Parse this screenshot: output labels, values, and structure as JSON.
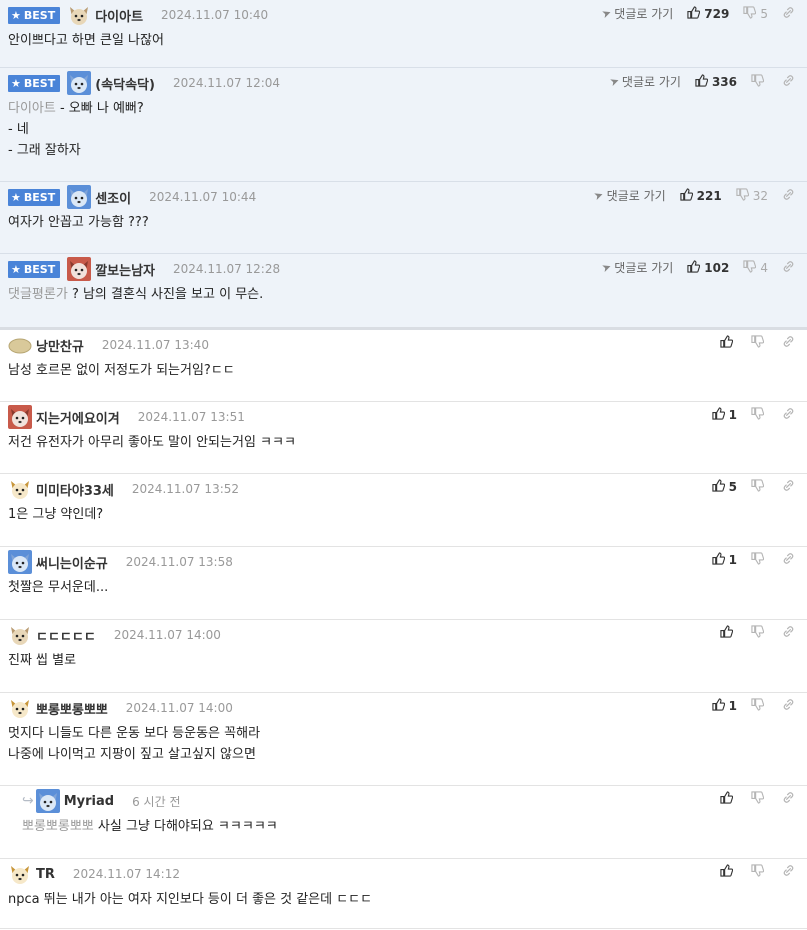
{
  "common": {
    "best_label": "BEST",
    "goto_label": "댓글로 가기"
  },
  "comments": [
    {
      "best": true,
      "avatar": "dog-cream",
      "nick": "다이아트",
      "date": "2024.11.07 10:40",
      "mention": "",
      "lines": [
        "안이쁘다고 하면 큰일 나잖어"
      ],
      "likes": "729",
      "dislikes": "5"
    },
    {
      "best": true,
      "avatar": "dog-blue",
      "nick": "(속닥속닥)",
      "date": "2024.11.07 12:04",
      "mention": "다이아트",
      "lines": [
        " - 오빠 나 예뻐?",
        "- 네",
        "- 그래 잘하자"
      ],
      "likes": "336",
      "dislikes": ""
    },
    {
      "best": true,
      "avatar": "dog-blue",
      "nick": "센조이",
      "date": "2024.11.07 10:44",
      "mention": "",
      "lines": [
        "여자가 안꼽고 가능함 ???"
      ],
      "likes": "221",
      "dislikes": "32"
    },
    {
      "best": true,
      "avatar": "dog-red",
      "nick": "깔보는남자",
      "date": "2024.11.07 12:28",
      "mention": "댓글평론가",
      "lines": [
        " ? 남의 결혼식 사진을 보고 이 무슨."
      ],
      "likes": "102",
      "dislikes": "4"
    },
    {
      "best": false,
      "avatar": "potato",
      "nick": "낭만찬규",
      "date": "2024.11.07 13:40",
      "mention": "",
      "lines": [
        "남성 호르몬 없이 저정도가 되는거임?ㄷㄷ"
      ],
      "likes": "",
      "dislikes": ""
    },
    {
      "best": false,
      "avatar": "dog-red",
      "nick": "지는거에요이겨",
      "date": "2024.11.07 13:51",
      "mention": "",
      "lines": [
        "저건 유전자가 아무리 좋아도 말이 안되는거임 ㅋㅋㅋ"
      ],
      "likes": "1",
      "dislikes": ""
    },
    {
      "best": false,
      "avatar": "dog-yellow",
      "nick": "미미타야33세",
      "date": "2024.11.07 13:52",
      "mention": "",
      "lines": [
        "1은 그냥 약인데?"
      ],
      "likes": "5",
      "dislikes": ""
    },
    {
      "best": false,
      "avatar": "dog-blue",
      "nick": "써니는이순규",
      "date": "2024.11.07 13:58",
      "mention": "",
      "lines": [
        "첫짤은 무서운데..."
      ],
      "likes": "1",
      "dislikes": ""
    },
    {
      "best": false,
      "avatar": "dog-cream",
      "nick": "ㄷㄷㄷㄷㄷ",
      "date": "2024.11.07 14:00",
      "mention": "",
      "lines": [
        "진짜 씹 별로"
      ],
      "likes": "",
      "dislikes": ""
    },
    {
      "best": false,
      "avatar": "dog-yellow",
      "nick": "뽀롱뽀롱뽀뽀",
      "date": "2024.11.07 14:00",
      "mention": "",
      "lines": [
        "멋지다 니들도 다른 운동 보다 등운동은 꼭해라",
        "나중에 나이먹고 지팡이 짚고 살고싶지 않으면"
      ],
      "likes": "1",
      "dislikes": ""
    },
    {
      "best": false,
      "reply": true,
      "avatar": "dog-blue",
      "nick": "Myriad",
      "date": "6 시간 전",
      "mention": "뽀롱뽀롱뽀뽀",
      "lines": [
        " 사실 그냥 다해야되요 ㅋㅋㅋㅋㅋ"
      ],
      "likes": "",
      "dislikes": ""
    },
    {
      "best": false,
      "avatar": "dog-yellow",
      "nick": "TR",
      "date": "2024.11.07 14:12",
      "mention": "",
      "lines": [
        "npca 뛰는 내가 아는 여자 지인보다 등이 더 좋은 것 같은데 ㄷㄷㄷ"
      ],
      "likes": "",
      "dislikes": ""
    }
  ]
}
